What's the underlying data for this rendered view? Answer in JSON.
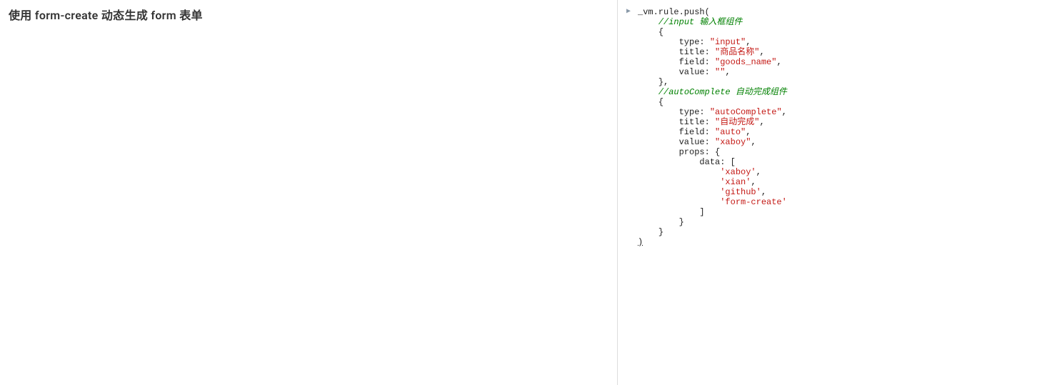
{
  "left": {
    "title": "使用 form-create 动态生成 form 表单"
  },
  "right": {
    "arrow": "▶",
    "code": [
      {
        "indent": "",
        "spans": [
          {
            "t": "_vm.rule.push(",
            "c": "default"
          }
        ]
      },
      {
        "indent": "    ",
        "spans": [
          {
            "t": "//input 输入框组件",
            "c": "comment"
          }
        ]
      },
      {
        "indent": "    ",
        "spans": [
          {
            "t": "{",
            "c": "default"
          }
        ]
      },
      {
        "indent": "        ",
        "spans": [
          {
            "t": "type: ",
            "c": "default"
          },
          {
            "t": "\"input\"",
            "c": "string"
          },
          {
            "t": ",",
            "c": "default"
          }
        ]
      },
      {
        "indent": "        ",
        "spans": [
          {
            "t": "title: ",
            "c": "default"
          },
          {
            "t": "\"商品名称\"",
            "c": "string"
          },
          {
            "t": ",",
            "c": "default"
          }
        ]
      },
      {
        "indent": "        ",
        "spans": [
          {
            "t": "field: ",
            "c": "default"
          },
          {
            "t": "\"goods_name\"",
            "c": "string"
          },
          {
            "t": ",",
            "c": "default"
          }
        ]
      },
      {
        "indent": "        ",
        "spans": [
          {
            "t": "value: ",
            "c": "default"
          },
          {
            "t": "\"\"",
            "c": "string"
          },
          {
            "t": ",",
            "c": "default"
          }
        ]
      },
      {
        "indent": "    ",
        "spans": [
          {
            "t": "},",
            "c": "default"
          }
        ]
      },
      {
        "indent": "    ",
        "spans": [
          {
            "t": "//autoComplete 自动完成组件",
            "c": "comment"
          }
        ]
      },
      {
        "indent": "    ",
        "spans": [
          {
            "t": "{",
            "c": "default"
          }
        ]
      },
      {
        "indent": "        ",
        "spans": [
          {
            "t": "type: ",
            "c": "default"
          },
          {
            "t": "\"autoComplete\"",
            "c": "string"
          },
          {
            "t": ",",
            "c": "default"
          }
        ]
      },
      {
        "indent": "        ",
        "spans": [
          {
            "t": "title: ",
            "c": "default"
          },
          {
            "t": "\"自动完成\"",
            "c": "string"
          },
          {
            "t": ",",
            "c": "default"
          }
        ]
      },
      {
        "indent": "        ",
        "spans": [
          {
            "t": "field: ",
            "c": "default"
          },
          {
            "t": "\"auto\"",
            "c": "string"
          },
          {
            "t": ",",
            "c": "default"
          }
        ]
      },
      {
        "indent": "        ",
        "spans": [
          {
            "t": "value: ",
            "c": "default"
          },
          {
            "t": "\"xaboy\"",
            "c": "string"
          },
          {
            "t": ",",
            "c": "default"
          }
        ]
      },
      {
        "indent": "        ",
        "spans": [
          {
            "t": "props: {",
            "c": "default"
          }
        ]
      },
      {
        "indent": "            ",
        "spans": [
          {
            "t": "data: [",
            "c": "default"
          }
        ]
      },
      {
        "indent": "                ",
        "spans": [
          {
            "t": "'xaboy'",
            "c": "string"
          },
          {
            "t": ",",
            "c": "default"
          }
        ]
      },
      {
        "indent": "                ",
        "spans": [
          {
            "t": "'xian'",
            "c": "string"
          },
          {
            "t": ",",
            "c": "default"
          }
        ]
      },
      {
        "indent": "                ",
        "spans": [
          {
            "t": "'github'",
            "c": "string"
          },
          {
            "t": ",",
            "c": "default"
          }
        ]
      },
      {
        "indent": "                ",
        "spans": [
          {
            "t": "'form-create'",
            "c": "string"
          }
        ]
      },
      {
        "indent": "            ",
        "spans": [
          {
            "t": "]",
            "c": "default"
          }
        ]
      },
      {
        "indent": "        ",
        "spans": [
          {
            "t": "}",
            "c": "default"
          }
        ]
      },
      {
        "indent": "    ",
        "spans": [
          {
            "t": "}",
            "c": "default"
          }
        ]
      },
      {
        "indent": "",
        "spans": [
          {
            "t": ")",
            "c": "default",
            "u": true
          }
        ]
      }
    ]
  }
}
